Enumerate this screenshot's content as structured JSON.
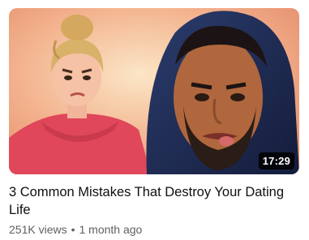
{
  "video": {
    "duration": "17:29",
    "title": "3 Common Mistakes That Destroy Your Dating Life",
    "views": "251K views",
    "separator": "•",
    "age": "1 month ago"
  },
  "colors": {
    "title": "#0f0f0f",
    "meta": "#606060",
    "duration_bg": "#000000"
  }
}
